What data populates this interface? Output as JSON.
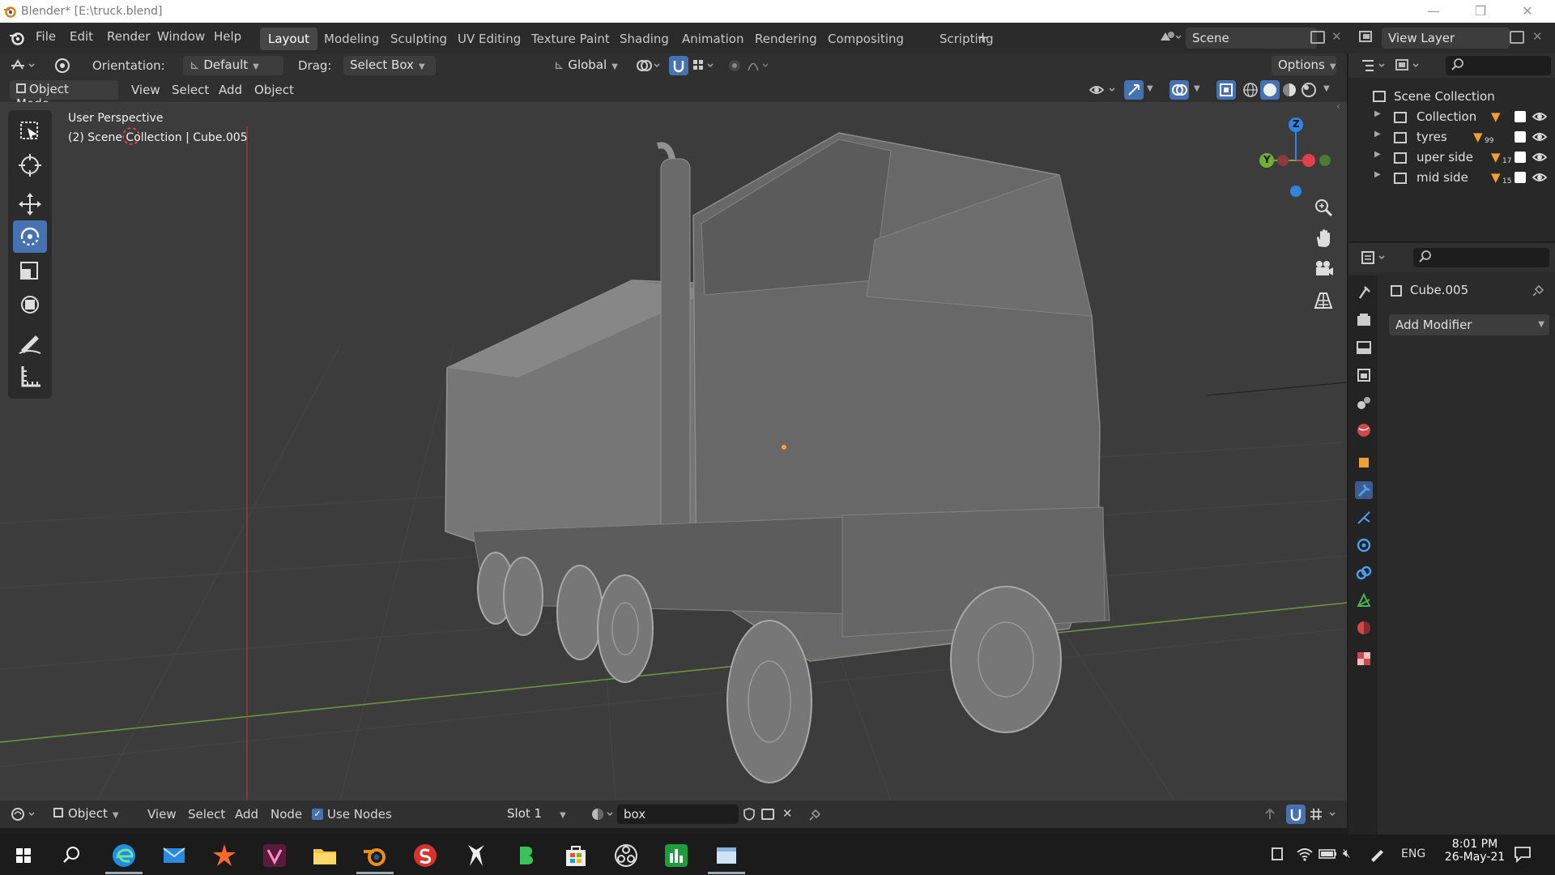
{
  "window": {
    "title": "Blender* [E:\\truck.blend]"
  },
  "menu": {
    "file": "File",
    "edit": "Edit",
    "render": "Render",
    "window": "Window",
    "help": "Help"
  },
  "workspaces": [
    "Layout",
    "Modeling",
    "Sculpting",
    "UV Editing",
    "Texture Paint",
    "Shading",
    "Animation",
    "Rendering",
    "Compositing",
    "Scripting"
  ],
  "add_workspace": "+",
  "scene": {
    "name": "Scene",
    "view_layer": "View Layer"
  },
  "tool_header": {
    "orientation_label": "Orientation:",
    "orientation_value": "Default",
    "drag_label": "Drag:",
    "drag_value": "Select Box",
    "transform_orientation": "Global",
    "options": "Options"
  },
  "mode_header": {
    "mode": "Object Mode",
    "view": "View",
    "select": "Select",
    "add": "Add",
    "object": "Object"
  },
  "viewport": {
    "perspective": "User Perspective",
    "context": "(2) Scene Collection | Cube.005",
    "gizmo_axes": {
      "z": "Z",
      "y": "Y"
    }
  },
  "outliner": {
    "root": "Scene Collection",
    "items": [
      {
        "name": "Collection",
        "badge": ""
      },
      {
        "name": "tyres",
        "badge": "99"
      },
      {
        "name": "uper side",
        "badge": "17"
      },
      {
        "name": "mid side",
        "badge": "15"
      }
    ]
  },
  "properties": {
    "object_name": "Cube.005",
    "add_modifier": "Add Modifier"
  },
  "shader_header": {
    "object": "Object",
    "view": "View",
    "select": "Select",
    "add": "Add",
    "node": "Node",
    "use_nodes": "Use Nodes",
    "slot": "Slot 1",
    "material": "box"
  },
  "taskbar": {
    "time": "8:01 PM",
    "date": "26-May-21",
    "lang": "ENG"
  },
  "colors": {
    "accent": "#4672b4",
    "x_axis": "#e0404e",
    "y_axis": "#70b030",
    "z_axis": "#2f85e0"
  }
}
